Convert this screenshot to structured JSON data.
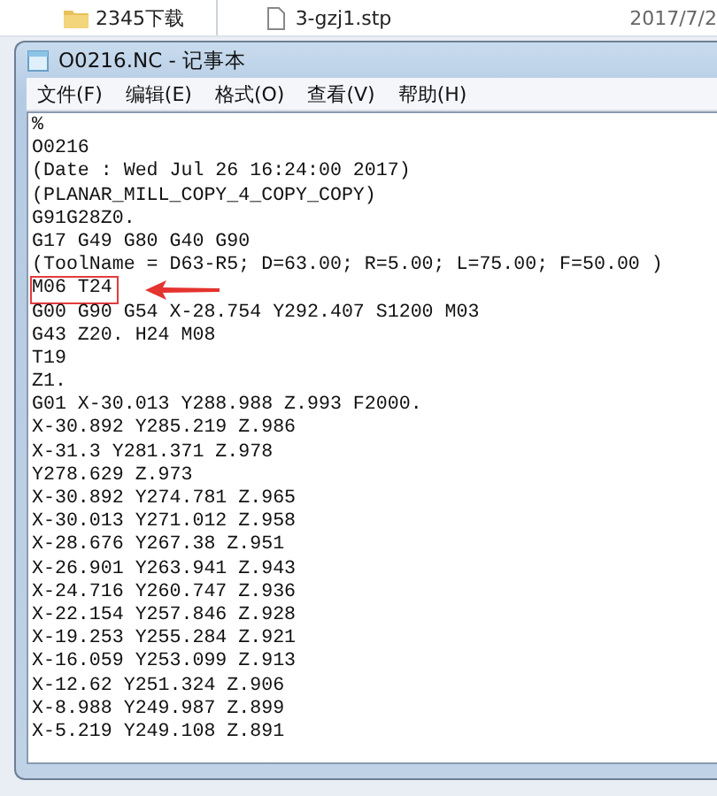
{
  "background": {
    "folder": "2345下载",
    "file": "3-gzj1.stp",
    "date": "2017/7/2"
  },
  "window": {
    "title": "O0216.NC - 记事本"
  },
  "menu": [
    "文件(F)",
    "编辑(E)",
    "格式(O)",
    "查看(V)",
    "帮助(H)"
  ],
  "lines": [
    {
      "text": "%",
      "highlighted": false
    },
    {
      "text": "O0216",
      "highlighted": false
    },
    {
      "text": "(Date : Wed Jul 26 16:24:00 2017)",
      "highlighted": false
    },
    {
      "text": "(PLANAR_MILL_COPY_4_COPY_COPY)",
      "highlighted": false
    },
    {
      "text": "G91G28Z0.",
      "highlighted": false
    },
    {
      "text": "G17 G49 G80 G40 G90",
      "highlighted": false
    },
    {
      "text": "(ToolName = D63-R5; D=63.00; R=5.00; L=75.00; F=50.00 )",
      "highlighted": false
    },
    {
      "text": "M06 T24",
      "highlighted": true
    },
    {
      "text": "G00 G90 G54 X-28.754 Y292.407 S1200 M03",
      "highlighted": false
    },
    {
      "text": "G43 Z20. H24 M08",
      "highlighted": false
    },
    {
      "text": "T19",
      "highlighted": false
    },
    {
      "text": "Z1.",
      "highlighted": false
    },
    {
      "text": "G01 X-30.013 Y288.988 Z.993 F2000.",
      "highlighted": false
    },
    {
      "text": "X-30.892 Y285.219 Z.986",
      "highlighted": false
    },
    {
      "text": "X-31.3 Y281.371 Z.978",
      "highlighted": false
    },
    {
      "text": "Y278.629 Z.973",
      "highlighted": false
    },
    {
      "text": "X-30.892 Y274.781 Z.965",
      "highlighted": false
    },
    {
      "text": "X-30.013 Y271.012 Z.958",
      "highlighted": false
    },
    {
      "text": "X-28.676 Y267.38 Z.951",
      "highlighted": false
    },
    {
      "text": "X-26.901 Y263.941 Z.943",
      "highlighted": false
    },
    {
      "text": "X-24.716 Y260.747 Z.936",
      "highlighted": false
    },
    {
      "text": "X-22.154 Y257.846 Z.928",
      "highlighted": false
    },
    {
      "text": "X-19.253 Y255.284 Z.921",
      "highlighted": false
    },
    {
      "text": "X-16.059 Y253.099 Z.913",
      "highlighted": false
    },
    {
      "text": "X-12.62 Y251.324 Z.906",
      "highlighted": false
    },
    {
      "text": "X-8.988 Y249.987 Z.899",
      "highlighted": false
    },
    {
      "text": "X-5.219 Y249.108 Z.891",
      "highlighted": false
    }
  ]
}
